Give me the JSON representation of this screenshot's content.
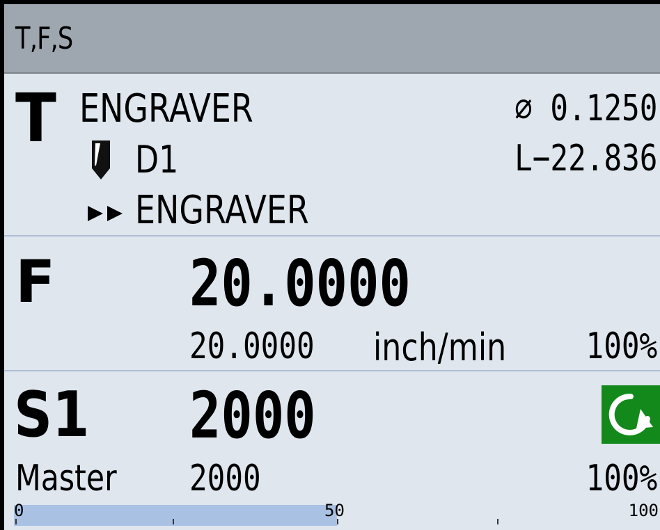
{
  "header": {
    "title": "T,F,S"
  },
  "tool": {
    "letter": "T",
    "name": "ENGRAVER",
    "edge": "D1",
    "next_tool": "ENGRAVER",
    "diameter": "⌀ 0.1250",
    "length": "L−22.836",
    "icons": {
      "tool": "tool-shank-icon",
      "next": "double-arrow-icon"
    }
  },
  "feed": {
    "letter": "F",
    "value": "20.0000",
    "actual": "20.0000",
    "unit": "inch/min",
    "override": "100%"
  },
  "spindle": {
    "letter": "S1",
    "value": "2000",
    "label": "Master",
    "actual": "2000",
    "override": "100%",
    "direction_icon": "spindle-rotation-cw-icon",
    "icon_color": "#12891a",
    "load_percent": 50,
    "scale": {
      "min": "0",
      "mid": "50",
      "max": "100"
    }
  }
}
